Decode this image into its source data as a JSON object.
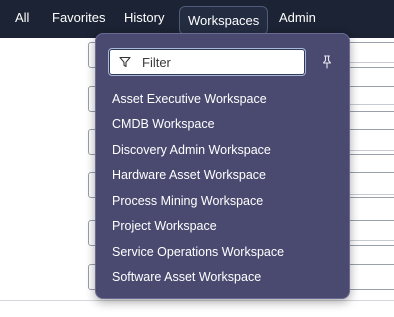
{
  "nav": {
    "tabs": [
      {
        "label": "All"
      },
      {
        "label": "Favorites"
      },
      {
        "label": "History"
      },
      {
        "label": "Workspaces"
      },
      {
        "label": "Admin"
      }
    ]
  },
  "menu": {
    "filter_placeholder": "Filter",
    "items": [
      {
        "label": "Asset Executive Workspace"
      },
      {
        "label": "CMDB Workspace"
      },
      {
        "label": "Discovery Admin Workspace"
      },
      {
        "label": "Hardware Asset Workspace"
      },
      {
        "label": "Process Mining Workspace"
      },
      {
        "label": "Project Workspace"
      },
      {
        "label": "Service Operations Workspace"
      },
      {
        "label": "Software Asset Workspace"
      }
    ]
  },
  "icons": {
    "filter": "filter-icon",
    "pin": "pin-icon"
  },
  "colors": {
    "topbar": "#1b2334",
    "menu_background": "#4a4a71",
    "menu_text": "#ffffff"
  }
}
